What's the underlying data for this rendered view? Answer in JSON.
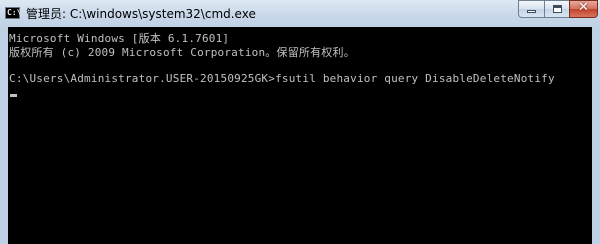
{
  "window": {
    "title": "管理员: C:\\windows\\system32\\cmd.exe",
    "icon_text": "C:\\",
    "controls": {
      "minimize": "minimize-icon",
      "maximize": "maximize-icon",
      "close": "✕"
    }
  },
  "console": {
    "lines": [
      "Microsoft Windows [版本 6.1.7601]",
      "版权所有 (c) 2009 Microsoft Corporation。保留所有权利。",
      "C:\\Users\\Administrator.USER-20150925GK>fsutil behavior query DisableDeleteNotify"
    ]
  },
  "colors": {
    "console_bg": "#000000",
    "console_text": "#c0c0c0",
    "close_button": "#c2422b"
  }
}
